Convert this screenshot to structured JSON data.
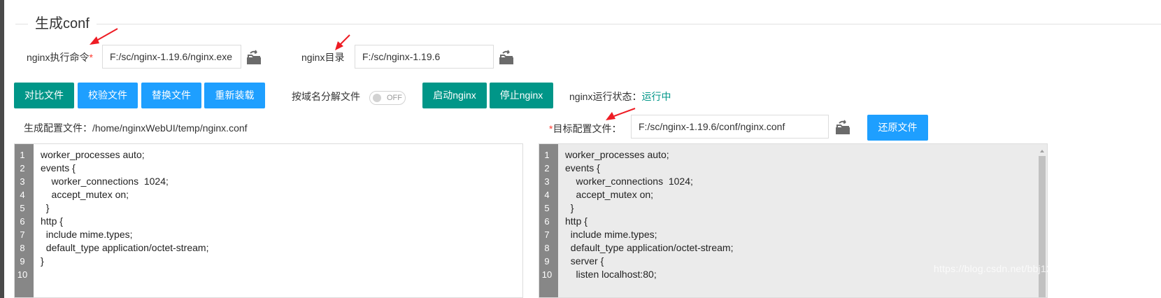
{
  "section": {
    "title": "生成conf"
  },
  "nginx_exe": {
    "label": "nginx执行命令",
    "required_mark": "*",
    "value": "F:/sc/nginx-1.19.6/nginx.exe"
  },
  "nginx_dir": {
    "label": "nginx目录",
    "value": "F:/sc/nginx-1.19.6"
  },
  "toolbar": {
    "compare_label": "对比文件",
    "verify_label": "校验文件",
    "replace_label": "替换文件",
    "reload_label": "重新装载",
    "split_by_domain_label": "按域名分解文件",
    "switch_text": "OFF",
    "start_label": "启动nginx",
    "stop_label": "停止nginx",
    "status_label": "nginx运行状态：",
    "status_value": "运行中"
  },
  "generated": {
    "label": "生成配置文件：",
    "path": "/home/nginxWebUI/temp/nginx.conf"
  },
  "target": {
    "required_mark": "*",
    "label": "目标配置文件：",
    "value": "F:/sc/nginx-1.19.6/conf/nginx.conf",
    "restore_label": "还原文件"
  },
  "left_editor": {
    "lines": [
      {
        "n": "1",
        "t": "worker_processes auto;"
      },
      {
        "n": "2",
        "t": "events {"
      },
      {
        "n": "3",
        "t": "    worker_connections  1024;"
      },
      {
        "n": "4",
        "t": "    accept_mutex on;"
      },
      {
        "n": "5",
        "t": "  }"
      },
      {
        "n": "6",
        "t": "http {"
      },
      {
        "n": "7",
        "t": "  include mime.types;"
      },
      {
        "n": "8",
        "t": "  default_type application/octet-stream;"
      },
      {
        "n": "9",
        "t": "}"
      },
      {
        "n": "10",
        "t": ""
      }
    ]
  },
  "right_editor": {
    "lines": [
      {
        "n": "1",
        "t": "worker_processes auto;"
      },
      {
        "n": "2",
        "t": "events {"
      },
      {
        "n": "3",
        "t": "    worker_connections  1024;"
      },
      {
        "n": "4",
        "t": "    accept_mutex on;"
      },
      {
        "n": "5",
        "t": "  }"
      },
      {
        "n": "6",
        "t": "http {"
      },
      {
        "n": "7",
        "t": "  include mime.types;"
      },
      {
        "n": "8",
        "t": "  default_type application/octet-stream;"
      },
      {
        "n": "9",
        "t": "  server {"
      },
      {
        "n": "10",
        "t": "    listen localhost:80;"
      }
    ]
  },
  "watermark": "https://blog.csdn.net/bbj12345678",
  "colors": {
    "green": "#009688",
    "blue": "#1e9fff",
    "required": "#ff3b30",
    "annotation_arrow": "#ee1c24"
  },
  "icons": [
    "folder-open-icon",
    "red-arrow-annotation"
  ]
}
